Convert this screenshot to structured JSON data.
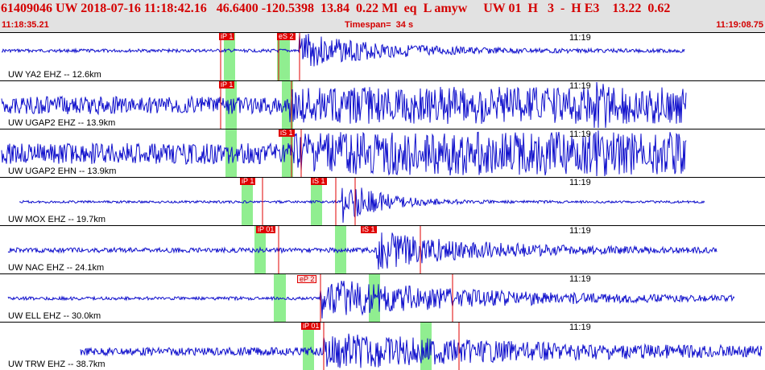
{
  "header": {
    "event_line": "61409046 UW 2018-07-16 11:18:42.16   46.6400 -120.5398  13.84  0.22 Ml  eq  L amyw     UW 01  H   3  -  H E3    13.22  0.62",
    "time_start": "11:18:35.21",
    "timespan": "Timespan=  34 s",
    "time_end": "11:19:08.75"
  },
  "colors": {
    "waveform": "#1010cc",
    "pick": "#e00000",
    "window": "#90ee90",
    "header_bg": "#e2e2e2",
    "header_text": "#d40000"
  },
  "traces": [
    {
      "label": "UW YA2 EHZ -- 12.6km",
      "minute": "11:19",
      "picks": [
        {
          "text": "iP 1",
          "light": false
        },
        {
          "text": "eS 2",
          "light": false
        }
      ]
    },
    {
      "label": "UW UGAP2 EHZ -- 13.9km",
      "minute": "11:19",
      "picks": [
        {
          "text": "iP 1",
          "light": false
        }
      ]
    },
    {
      "label": "UW UGAP2 EHN -- 13.9km",
      "minute": "11:19",
      "picks": [
        {
          "text": "iS 1",
          "light": false
        }
      ]
    },
    {
      "label": "UW MOX EHZ -- 19.7km",
      "minute": "11:19",
      "picks": [
        {
          "text": "iP 1",
          "light": false
        },
        {
          "text": "iS 1",
          "light": false
        }
      ]
    },
    {
      "label": "UW NAC EHZ -- 24.1km",
      "minute": "11:19",
      "picks": [
        {
          "text": "iP 01",
          "light": false
        },
        {
          "text": "iS 1",
          "light": false
        }
      ]
    },
    {
      "label": "UW ELL EHZ -- 30.0km",
      "minute": "11:19",
      "picks": [
        {
          "text": "eP 2",
          "light": true
        }
      ]
    },
    {
      "label": "UW TRW EHZ -- 38.7km",
      "minute": "11:19",
      "picks": [
        {
          "text": "iP 01",
          "light": false
        }
      ]
    }
  ]
}
